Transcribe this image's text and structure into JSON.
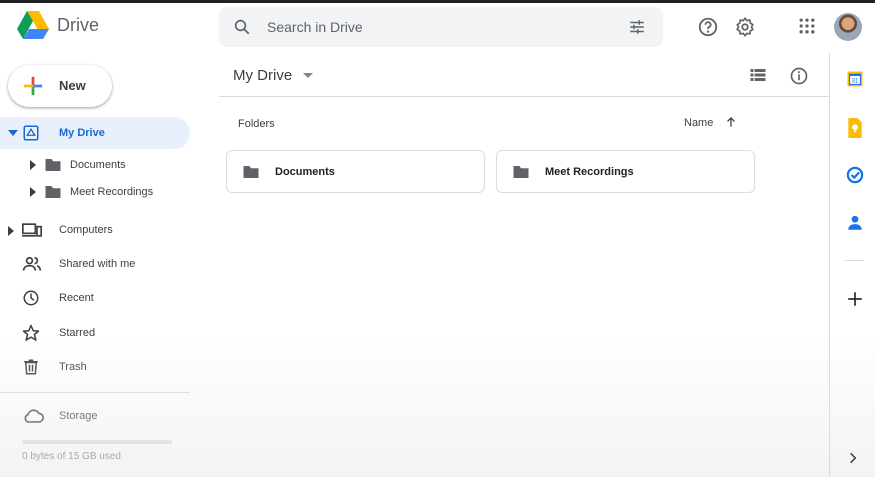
{
  "app": {
    "name": "Drive"
  },
  "search": {
    "placeholder": "Search in Drive"
  },
  "sidebar": {
    "new_label": "New",
    "my_drive": "My Drive",
    "subfolders": [
      "Documents",
      "Meet Recordings"
    ],
    "computers": "Computers",
    "shared": "Shared with me",
    "recent": "Recent",
    "starred": "Starred",
    "trash": "Trash",
    "storage": "Storage",
    "storage_used": "0 bytes of 15 GB used",
    "storage_fraction": 0
  },
  "main": {
    "title": "My Drive",
    "section": "Folders",
    "sort_label": "Name",
    "folders": [
      "Documents",
      "Meet Recordings"
    ]
  },
  "colors": {
    "accent": "#1967d2",
    "active_bg": "#e8f0fe"
  }
}
